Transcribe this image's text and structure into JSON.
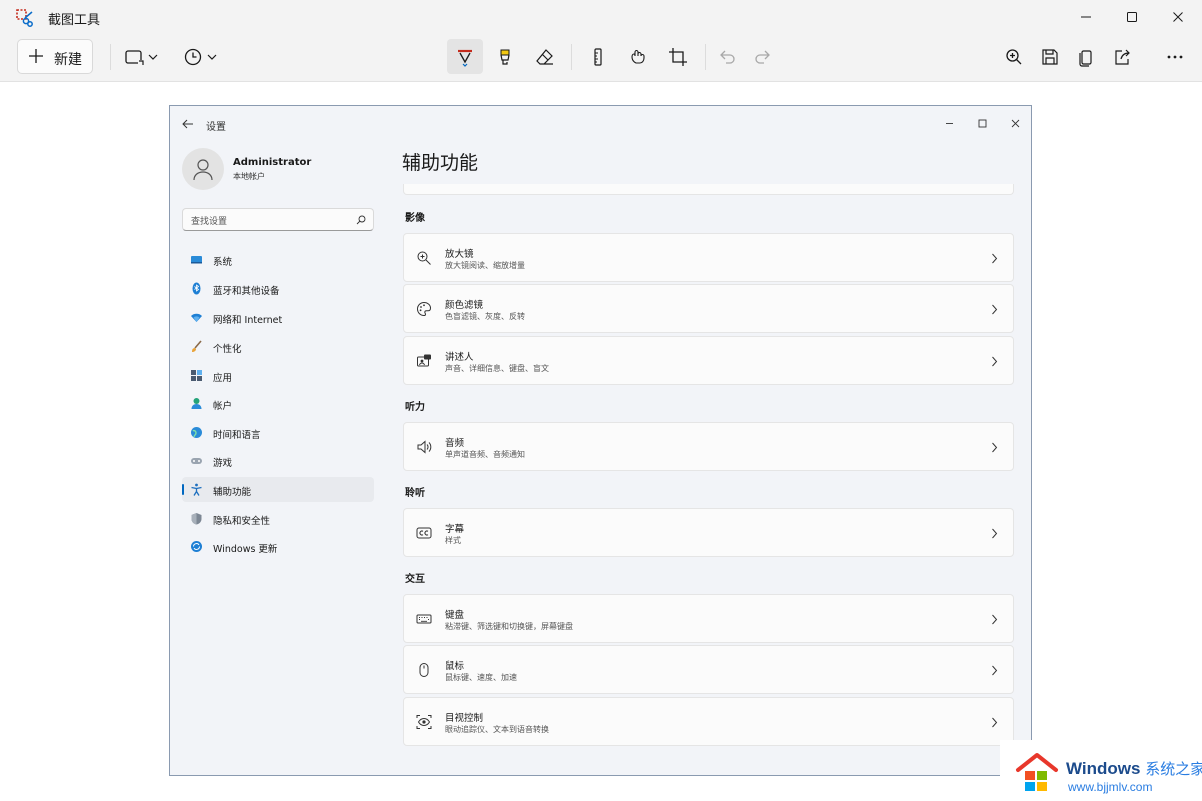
{
  "app": {
    "title": "截图工具",
    "new_label": "新建"
  },
  "settings": {
    "window_title": "设置",
    "profile": {
      "name": "Administrator",
      "type": "本地帐户"
    },
    "search_placeholder": "查找设置",
    "nav": [
      {
        "label": "系统",
        "icon": "monitor-icon"
      },
      {
        "label": "蓝牙和其他设备",
        "icon": "bluetooth-icon"
      },
      {
        "label": "网络和 Internet",
        "icon": "wifi-icon"
      },
      {
        "label": "个性化",
        "icon": "brush-icon"
      },
      {
        "label": "应用",
        "icon": "apps-icon"
      },
      {
        "label": "帐户",
        "icon": "person-icon"
      },
      {
        "label": "时间和语言",
        "icon": "globe-clock-icon"
      },
      {
        "label": "游戏",
        "icon": "gamepad-icon"
      },
      {
        "label": "辅助功能",
        "icon": "accessibility-icon",
        "selected": true
      },
      {
        "label": "隐私和安全性",
        "icon": "shield-icon"
      },
      {
        "label": "Windows 更新",
        "icon": "update-icon"
      }
    ],
    "page_title": "辅助功能",
    "sections": [
      {
        "title": "影像",
        "cards": [
          {
            "title": "放大镜",
            "subtitle": "放大镜阅读、缩放增量",
            "icon": "magnifier-icon"
          },
          {
            "title": "颜色滤镜",
            "subtitle": "色盲滤镜、灰度、反转",
            "icon": "palette-icon"
          },
          {
            "title": "讲述人",
            "subtitle": "声音、详细信息、键盘、盲文",
            "icon": "narrator-icon"
          }
        ]
      },
      {
        "title": "听力",
        "cards": [
          {
            "title": "音频",
            "subtitle": "单声道音频、音频通知",
            "icon": "speaker-icon"
          }
        ]
      },
      {
        "title": "聆听",
        "cards": [
          {
            "title": "字幕",
            "subtitle": "样式",
            "icon": "captions-icon"
          }
        ]
      },
      {
        "title": "交互",
        "cards": [
          {
            "title": "键盘",
            "subtitle": "粘滞键、筛选键和切换键，屏幕键盘",
            "icon": "keyboard-icon"
          },
          {
            "title": "鼠标",
            "subtitle": "鼠标键、速度、加速",
            "icon": "mouse-icon"
          },
          {
            "title": "目视控制",
            "subtitle": "眼动追踪仪、文本到语音转换",
            "icon": "eye-control-icon"
          }
        ]
      }
    ]
  },
  "watermark": {
    "title": "Windows",
    "title_cn": "系统之家",
    "url": "www.bjjmlv.com"
  },
  "colors": {
    "accent": "#0067c0",
    "pen_red": "#c42b1c",
    "highlighter_yellow": "#f2c811"
  }
}
